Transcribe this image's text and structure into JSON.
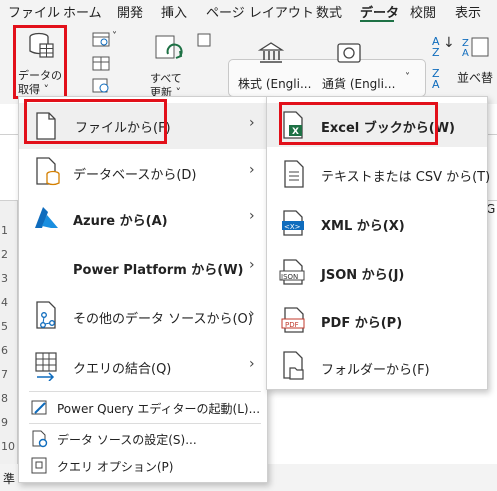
{
  "ribbon_tabs": [
    "ファイル",
    "ホーム",
    "開発",
    "挿入",
    "ページ レイアウト",
    "数式",
    "データ",
    "校閲",
    "表示"
  ],
  "ribbon": {
    "get_data_line1": "データの",
    "get_data_line2": "取得 ˅",
    "refresh_all_line1": "すべて",
    "refresh_all_line2": "更新 ˅",
    "stocks_label": "株式 (Engli...",
    "currency_label": "通貨 (Engli...",
    "sort_label": "並べ替",
    "side_glyph": "替",
    "sort_az_top": "A",
    "sort_az_bottom": "Z"
  },
  "sheet": {
    "row_numbers": [
      "1",
      "2",
      "3",
      "4",
      "5",
      "6",
      "7",
      "8",
      "9",
      "10"
    ],
    "col_header_right": "G",
    "status_left": "準"
  },
  "main_menu": {
    "items": [
      {
        "label": "ファイルから(F)",
        "icon": "file-icon"
      },
      {
        "label": "データベースから(D)",
        "icon": "database-icon"
      },
      {
        "label": "Azure から(A)",
        "icon": "azure-icon"
      },
      {
        "label": "Power Platform から(W)",
        "icon": "none"
      },
      {
        "label": "その他のデータ ソースから(O)",
        "icon": "other-sources-icon"
      },
      {
        "label": "クエリの結合(Q)",
        "icon": "combine-queries-icon"
      }
    ],
    "footer_items": [
      {
        "label": "Power Query エディターの起動(L)...",
        "icon": "power-query-editor-icon"
      },
      {
        "label": "データ ソースの設定(S)...",
        "icon": "data-source-settings-icon"
      },
      {
        "label": "クエリ オプション(P)",
        "icon": "query-options-icon"
      }
    ]
  },
  "file_submenu": {
    "items": [
      {
        "label": "Excel ブックから(W)",
        "icon": "excel-workbook-icon"
      },
      {
        "label": "テキストまたは CSV から(T)",
        "icon": "text-csv-icon"
      },
      {
        "label": "XML から(X)",
        "icon": "xml-icon"
      },
      {
        "label": "JSON から(J)",
        "icon": "json-icon"
      },
      {
        "label": "PDF から(P)",
        "icon": "pdf-icon"
      },
      {
        "label": "フォルダーから(F)",
        "icon": "folder-icon"
      }
    ],
    "icon_text": {
      "excel": "X",
      "xml": "<X>",
      "json": "JSON",
      "pdf": "PDF"
    }
  },
  "colors": {
    "highlight_border": "#e2101a",
    "excel_green": "#1e7145",
    "accent_blue": "#0f6cbd"
  }
}
